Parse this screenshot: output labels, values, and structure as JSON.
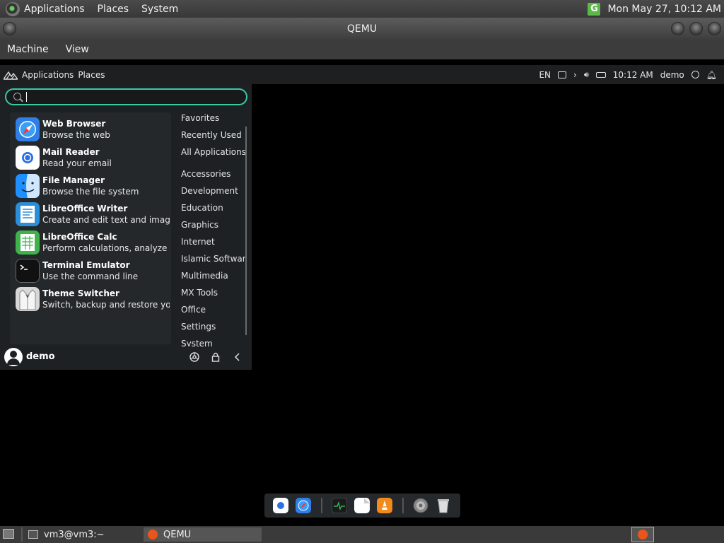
{
  "host_panel": {
    "menus": [
      "Applications",
      "Places",
      "System"
    ],
    "network_icon": "network-icon",
    "clock": "Mon May 27, 10:12 AM"
  },
  "qemu": {
    "title": "QEMU",
    "menus": [
      "Machine",
      "View"
    ]
  },
  "guest_topbar": {
    "left": [
      "Applications",
      "Places"
    ],
    "keyboard": "EN",
    "time": "10:12 AM",
    "user": "demo"
  },
  "menu": {
    "search_value": "",
    "favorites": [
      {
        "name": "Web Browser",
        "desc": "Browse the web",
        "icon": "safari-icon"
      },
      {
        "name": "Mail Reader",
        "desc": "Read your email",
        "icon": "mail-icon"
      },
      {
        "name": "File Manager",
        "desc": "Browse the file system",
        "icon": "finder-icon"
      },
      {
        "name": "LibreOffice Writer",
        "desc": "Create and edit text and imag...",
        "icon": "writer-icon"
      },
      {
        "name": "LibreOffice Calc",
        "desc": "Perform calculations, analyze ...",
        "icon": "calc-icon"
      },
      {
        "name": "Terminal Emulator",
        "desc": "Use the command line",
        "icon": "terminal-icon"
      },
      {
        "name": "Theme Switcher",
        "desc": "Switch, backup and restore yo...",
        "icon": "theme-icon"
      }
    ],
    "categories": [
      "Favorites",
      "Recently Used",
      "All Applications",
      "Accessories",
      "Development",
      "Education",
      "Graphics",
      "Internet",
      "Islamic Software",
      "Multimedia",
      "MX Tools",
      "Office",
      "Settings",
      "System"
    ],
    "user": "demo"
  },
  "dock": {
    "icons": [
      "mail-icon",
      "safari-icon",
      "activity-monitor-icon",
      "files-icon",
      "vlc-icon",
      "settings-icon",
      "trash-icon"
    ]
  },
  "host_taskbar": {
    "tasks": [
      "vm3@vm3:~",
      "QEMU"
    ]
  }
}
